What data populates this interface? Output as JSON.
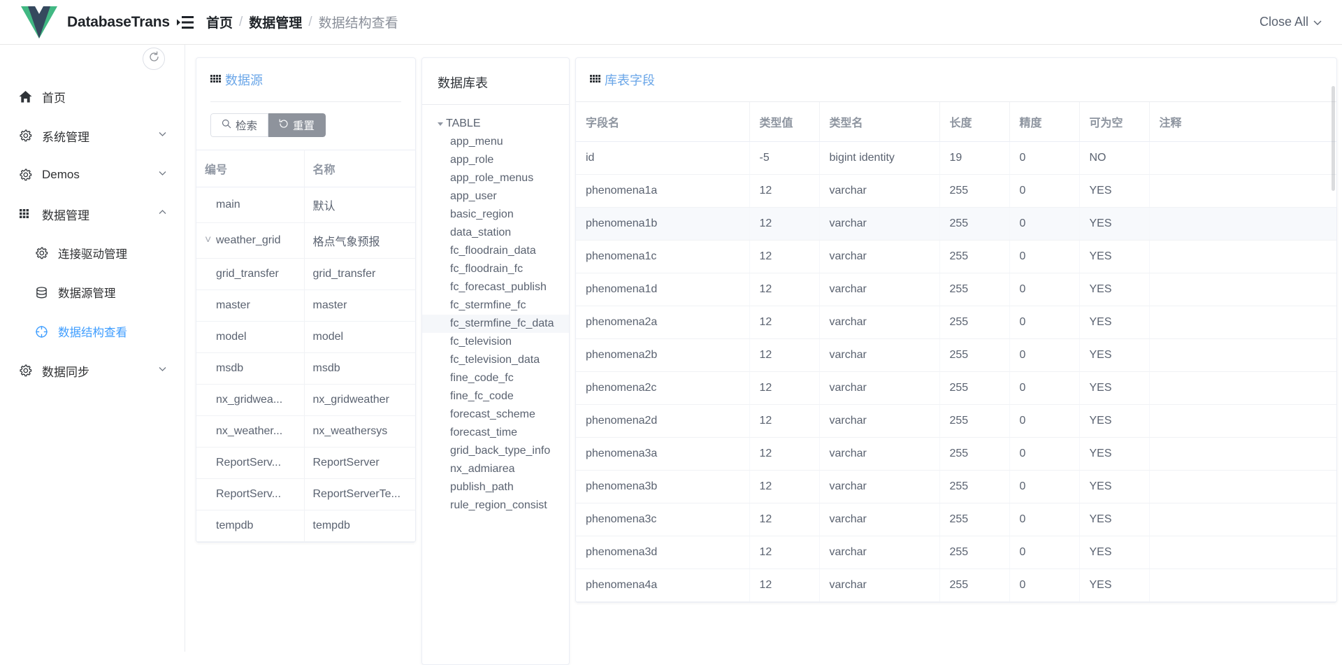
{
  "header": {
    "brand": "DatabaseTrans",
    "collapse_icon": "menu-fold-icon",
    "breadcrumb": [
      {
        "label": "首页",
        "muted": false
      },
      {
        "label": "数据管理",
        "muted": false
      },
      {
        "label": "数据结构查看",
        "muted": true
      }
    ],
    "separator": "/",
    "close_all": "Close All"
  },
  "sidebar": {
    "refresh_icon": "refresh-icon",
    "items": [
      {
        "label": "首页",
        "icon": "home-icon",
        "arrow": "",
        "active": false,
        "indent": false
      },
      {
        "label": "系统管理",
        "icon": "gear-icon",
        "arrow": "down",
        "active": false,
        "indent": false
      },
      {
        "label": "Demos",
        "icon": "gear-icon",
        "arrow": "down",
        "active": false,
        "indent": false
      },
      {
        "label": "数据管理",
        "icon": "grid-icon",
        "arrow": "up",
        "active": false,
        "indent": false
      },
      {
        "label": "连接驱动管理",
        "icon": "gear-icon",
        "arrow": "",
        "active": false,
        "indent": true
      },
      {
        "label": "数据源管理",
        "icon": "database-icon",
        "arrow": "",
        "active": false,
        "indent": true
      },
      {
        "label": "数据结构查看",
        "icon": "target-icon",
        "arrow": "",
        "active": true,
        "indent": true
      },
      {
        "label": "数据同步",
        "icon": "gear-icon",
        "arrow": "down",
        "active": false,
        "indent": false
      }
    ]
  },
  "datasource_panel": {
    "title": "数据源",
    "title_icon": "grid-icon",
    "search_button": "检索",
    "search_icon": "search-icon",
    "reset_button": "重置",
    "reset_icon": "reset-icon",
    "columns": [
      "编号",
      "名称"
    ],
    "rows": [
      {
        "id": "main",
        "name": "默认",
        "caret": false,
        "indent": true
      },
      {
        "id": "weather_grid",
        "name": "格点气象预报",
        "caret": true,
        "indent": false
      },
      {
        "id": "grid_transfer",
        "name": "grid_transfer",
        "caret": false,
        "indent": true
      },
      {
        "id": "master",
        "name": "master",
        "caret": false,
        "indent": true
      },
      {
        "id": "model",
        "name": "model",
        "caret": false,
        "indent": true
      },
      {
        "id": "msdb",
        "name": "msdb",
        "caret": false,
        "indent": true
      },
      {
        "id": "nx_gridwea...",
        "name": "nx_gridweather",
        "caret": false,
        "indent": true
      },
      {
        "id": "nx_weather...",
        "name": "nx_weathersys",
        "caret": false,
        "indent": true
      },
      {
        "id": "ReportServ...",
        "name": "ReportServer",
        "caret": false,
        "indent": true
      },
      {
        "id": "ReportServ...",
        "name": "ReportServerTe...",
        "caret": false,
        "indent": true
      },
      {
        "id": "tempdb",
        "name": "tempdb",
        "caret": false,
        "indent": true
      }
    ]
  },
  "tree_panel": {
    "title": "数据库表",
    "root": {
      "label": "TABLE",
      "expanded": true
    },
    "nodes": [
      {
        "label": "app_menu",
        "selected": false
      },
      {
        "label": "app_role",
        "selected": false
      },
      {
        "label": "app_role_menus",
        "selected": false
      },
      {
        "label": "app_user",
        "selected": false
      },
      {
        "label": "basic_region",
        "selected": false
      },
      {
        "label": "data_station",
        "selected": false
      },
      {
        "label": "fc_floodrain_data",
        "selected": false
      },
      {
        "label": "fc_floodrain_fc",
        "selected": false
      },
      {
        "label": "fc_forecast_publish",
        "selected": false
      },
      {
        "label": "fc_stermfine_fc",
        "selected": false
      },
      {
        "label": "fc_stermfine_fc_data",
        "selected": true
      },
      {
        "label": "fc_television",
        "selected": false
      },
      {
        "label": "fc_television_data",
        "selected": false
      },
      {
        "label": "fine_code_fc",
        "selected": false
      },
      {
        "label": "fine_fc_code",
        "selected": false
      },
      {
        "label": "forecast_scheme",
        "selected": false
      },
      {
        "label": "forecast_time",
        "selected": false
      },
      {
        "label": "grid_back_type_info",
        "selected": false
      },
      {
        "label": "nx_admiarea",
        "selected": false
      },
      {
        "label": "publish_path",
        "selected": false
      },
      {
        "label": "rule_region_consist",
        "selected": false
      }
    ]
  },
  "fields_panel": {
    "title": "库表字段",
    "title_icon": "grid-icon",
    "columns": [
      "字段名",
      "类型值",
      "类型名",
      "长度",
      "精度",
      "可为空",
      "注释"
    ],
    "rows": [
      {
        "field": "id",
        "type_value": "-5",
        "type_name": "bigint identity",
        "length": "19",
        "precision": "0",
        "nullable": "NO",
        "comment": ""
      },
      {
        "field": "phenomena1a",
        "type_value": "12",
        "type_name": "varchar",
        "length": "255",
        "precision": "0",
        "nullable": "YES",
        "comment": ""
      },
      {
        "field": "phenomena1b",
        "type_value": "12",
        "type_name": "varchar",
        "length": "255",
        "precision": "0",
        "nullable": "YES",
        "comment": ""
      },
      {
        "field": "phenomena1c",
        "type_value": "12",
        "type_name": "varchar",
        "length": "255",
        "precision": "0",
        "nullable": "YES",
        "comment": ""
      },
      {
        "field": "phenomena1d",
        "type_value": "12",
        "type_name": "varchar",
        "length": "255",
        "precision": "0",
        "nullable": "YES",
        "comment": ""
      },
      {
        "field": "phenomena2a",
        "type_value": "12",
        "type_name": "varchar",
        "length": "255",
        "precision": "0",
        "nullable": "YES",
        "comment": ""
      },
      {
        "field": "phenomena2b",
        "type_value": "12",
        "type_name": "varchar",
        "length": "255",
        "precision": "0",
        "nullable": "YES",
        "comment": ""
      },
      {
        "field": "phenomena2c",
        "type_value": "12",
        "type_name": "varchar",
        "length": "255",
        "precision": "0",
        "nullable": "YES",
        "comment": ""
      },
      {
        "field": "phenomena2d",
        "type_value": "12",
        "type_name": "varchar",
        "length": "255",
        "precision": "0",
        "nullable": "YES",
        "comment": ""
      },
      {
        "field": "phenomena3a",
        "type_value": "12",
        "type_name": "varchar",
        "length": "255",
        "precision": "0",
        "nullable": "YES",
        "comment": ""
      },
      {
        "field": "phenomena3b",
        "type_value": "12",
        "type_name": "varchar",
        "length": "255",
        "precision": "0",
        "nullable": "YES",
        "comment": ""
      },
      {
        "field": "phenomena3c",
        "type_value": "12",
        "type_name": "varchar",
        "length": "255",
        "precision": "0",
        "nullable": "YES",
        "comment": ""
      },
      {
        "field": "phenomena3d",
        "type_value": "12",
        "type_name": "varchar",
        "length": "255",
        "precision": "0",
        "nullable": "YES",
        "comment": ""
      },
      {
        "field": "phenomena4a",
        "type_value": "12",
        "type_name": "varchar",
        "length": "255",
        "precision": "0",
        "nullable": "YES",
        "comment": ""
      }
    ],
    "highlighted_row_index": 2
  },
  "colors": {
    "accent": "#409eff",
    "link": "#6aa6e8",
    "vue_green": "#41b883",
    "vue_dark": "#35495e",
    "text": "#5a6270",
    "muted": "#9097a3",
    "border": "#ebeef5"
  }
}
